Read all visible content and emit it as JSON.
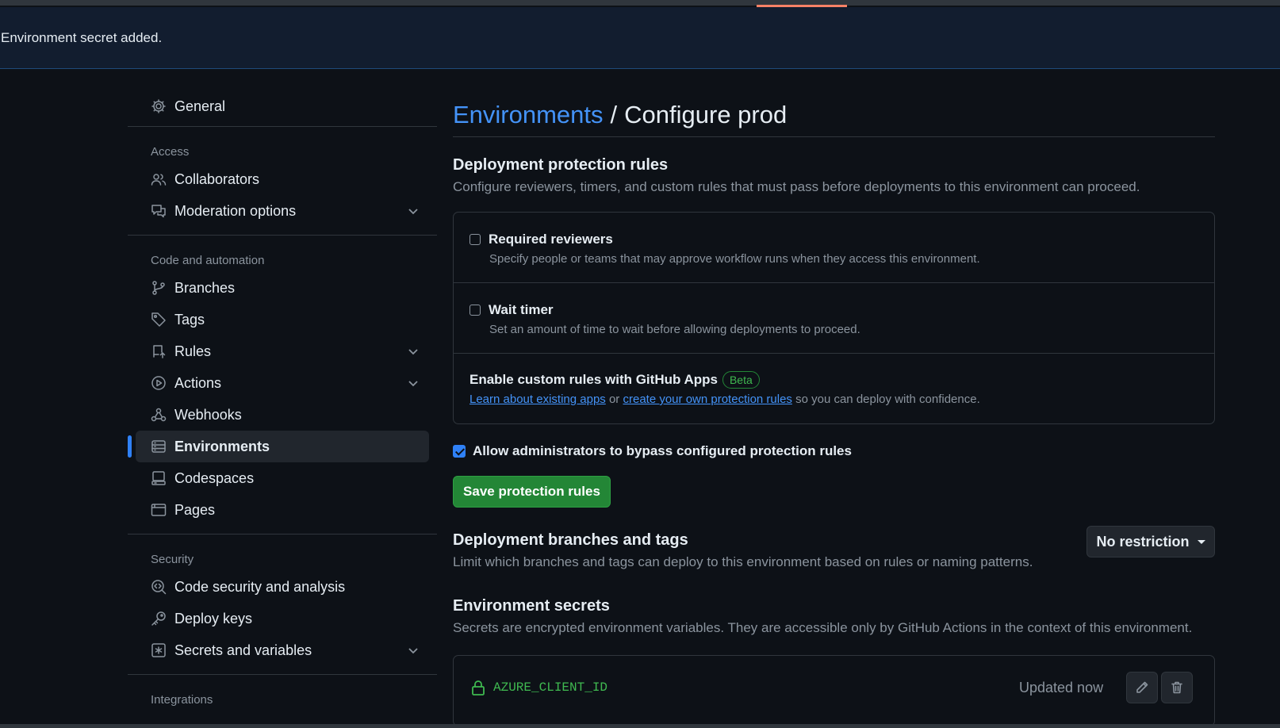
{
  "flash": {
    "message": "Environment secret added."
  },
  "sidebar": {
    "general": {
      "label": "General",
      "icon": "gear-icon"
    },
    "sections": [
      {
        "heading": "Access"
      },
      {
        "heading": "Code and automation"
      },
      {
        "heading": "Security"
      },
      {
        "heading": "Integrations"
      }
    ],
    "items": [
      {
        "label": "Collaborators",
        "icon": "people-icon"
      },
      {
        "label": "Moderation options",
        "icon": "comment-discussion-icon",
        "expandable": true
      },
      {
        "label": "Branches",
        "icon": "git-branch-icon"
      },
      {
        "label": "Tags",
        "icon": "tag-icon"
      },
      {
        "label": "Rules",
        "icon": "repo-push-icon",
        "expandable": true
      },
      {
        "label": "Actions",
        "icon": "play-icon",
        "expandable": true
      },
      {
        "label": "Webhooks",
        "icon": "webhook-icon"
      },
      {
        "label": "Environments",
        "icon": "server-icon",
        "active": true
      },
      {
        "label": "Codespaces",
        "icon": "codespaces-icon"
      },
      {
        "label": "Pages",
        "icon": "browser-icon"
      },
      {
        "label": "Code security and analysis",
        "icon": "codescan-icon"
      },
      {
        "label": "Deploy keys",
        "icon": "key-icon"
      },
      {
        "label": "Secrets and variables",
        "icon": "asterisk-icon",
        "expandable": true
      }
    ]
  },
  "main": {
    "breadcrumb_link": "Environments",
    "breadcrumb_sep": "/",
    "breadcrumb_current": "Configure prod",
    "protection": {
      "title": "Deployment protection rules",
      "description": "Configure reviewers, timers, and custom rules that must pass before deployments to this environment can proceed.",
      "required_reviewers": {
        "label": "Required reviewers",
        "description": "Specify people or teams that may approve workflow runs when they access this environment.",
        "checked": false
      },
      "wait_timer": {
        "label": "Wait timer",
        "description": "Set an amount of time to wait before allowing deployments to proceed.",
        "checked": false
      },
      "custom_rules": {
        "label": "Enable custom rules with GitHub Apps",
        "badge": "Beta",
        "link1": "Learn about existing apps",
        "or": " or ",
        "link2": "create your own protection rules",
        "suffix": " so you can deploy with confidence."
      },
      "bypass": {
        "label": "Allow administrators to bypass configured protection rules",
        "checked": true
      },
      "save_label": "Save protection rules"
    },
    "branches": {
      "title": "Deployment branches and tags",
      "description": "Limit which branches and tags can deploy to this environment based on rules or naming patterns.",
      "dropdown_label": "No restriction"
    },
    "secrets": {
      "title": "Environment secrets",
      "description": "Secrets are encrypted environment variables. They are accessible only by GitHub Actions in the context of this environment.",
      "items": [
        {
          "name": "AZURE_CLIENT_ID",
          "updated": "Updated now"
        }
      ]
    }
  },
  "colors": {
    "accent": "#2f81f7",
    "success": "#238636",
    "link": "#4493f8",
    "background": "#0d1117"
  }
}
